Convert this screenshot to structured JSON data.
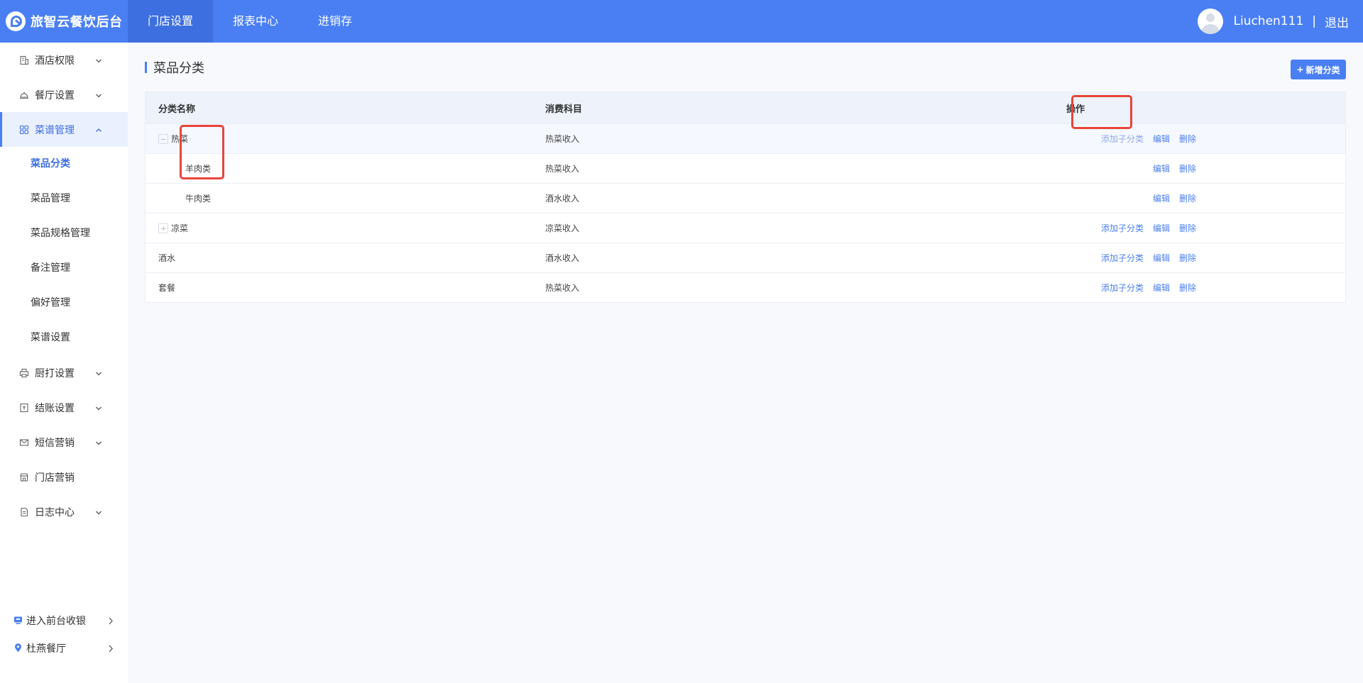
{
  "brand": {
    "name": "旅智云餐饮后台"
  },
  "topnav": [
    "门店设置",
    "报表中心",
    "进销存"
  ],
  "user": {
    "name": "Liuchen111",
    "separator": "|",
    "logout": "退出"
  },
  "sidebar": {
    "menu_top": [
      {
        "label": "酒店权限",
        "icon": "hotel-icon"
      },
      {
        "label": "餐厅设置",
        "icon": "cloche-icon"
      },
      {
        "label": "菜谱管理",
        "icon": "grid-icon"
      }
    ],
    "submenu": [
      "菜品分类",
      "菜品管理",
      "菜品规格管理",
      "备注管理",
      "偏好管理",
      "菜谱设置"
    ],
    "menu_bottom": [
      {
        "label": "厨打设置",
        "icon": "printer-icon"
      },
      {
        "label": "结账设置",
        "icon": "checkout-icon"
      },
      {
        "label": "短信营销",
        "icon": "mail-icon"
      },
      {
        "label": "门店营销",
        "icon": "store-icon"
      },
      {
        "label": "日志中心",
        "icon": "log-icon"
      }
    ],
    "links": [
      {
        "label": "进入前台收银",
        "icon": "cashier-icon"
      },
      {
        "label": "杜燕餐厅",
        "icon": "location-pin-icon"
      }
    ]
  },
  "page": {
    "title": "菜品分类",
    "add_button": "新增分类"
  },
  "table": {
    "headers": {
      "name": "分类名称",
      "subject": "消费科目",
      "actions": "操作"
    },
    "rows": [
      {
        "name": "热菜",
        "subject": "热菜收入",
        "toggle": "expanded",
        "child": false,
        "actions": [
          "添加子分类",
          "编辑",
          "删除"
        ]
      },
      {
        "name": "羊肉类",
        "subject": "热菜收入",
        "toggle": "none",
        "child": true,
        "actions": [
          "编辑",
          "删除"
        ]
      },
      {
        "name": "牛肉类",
        "subject": "酒水收入",
        "toggle": "none",
        "child": true,
        "actions": [
          "编辑",
          "删除"
        ]
      },
      {
        "name": "凉菜",
        "subject": "凉菜收入",
        "toggle": "collapsed",
        "child": false,
        "actions": [
          "添加子分类",
          "编辑",
          "删除"
        ]
      },
      {
        "name": "酒水",
        "subject": "酒水收入",
        "toggle": "none",
        "child": false,
        "actions": [
          "添加子分类",
          "编辑",
          "删除"
        ]
      },
      {
        "name": "套餐",
        "subject": "热菜收入",
        "toggle": "none",
        "child": false,
        "actions": [
          "添加子分类",
          "编辑",
          "删除"
        ]
      }
    ]
  },
  "colors": {
    "primary": "#4a7ff3",
    "highlight": "#e9443b"
  }
}
